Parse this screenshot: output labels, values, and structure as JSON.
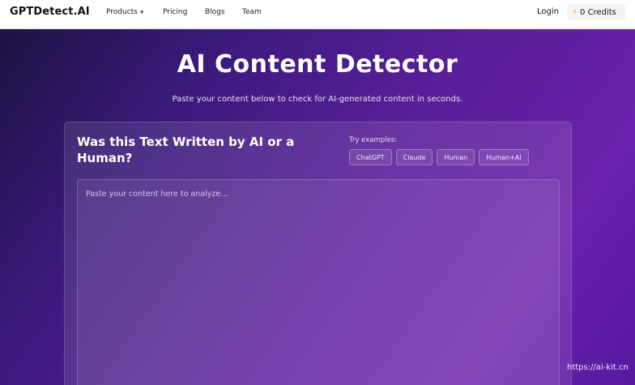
{
  "nav": {
    "logo": "GPTDetect.AI",
    "items": [
      {
        "label": "Products",
        "has_dropdown": true
      },
      {
        "label": "Pricing"
      },
      {
        "label": "Blogs"
      },
      {
        "label": "Team"
      }
    ],
    "login": "Login",
    "credits": "0 Credits",
    "credits_icon": "lightning-icon"
  },
  "hero": {
    "title": "AI Content Detector",
    "subtitle": "Paste your content below to check for AI-generated content in seconds."
  },
  "card": {
    "title": "Was this Text Written by AI or a Human?",
    "try_label": "Try examples:",
    "examples": [
      "ChatGPT",
      "Claude",
      "Human",
      "Human+AI"
    ],
    "textarea_placeholder": "Paste your content here to analyze..."
  },
  "watermark": "https://ai-kit.cn",
  "colors": {
    "gradient_dark": "#1c1240",
    "gradient_purple": "#6a22aa",
    "accent_bolt": "#f5a623"
  }
}
